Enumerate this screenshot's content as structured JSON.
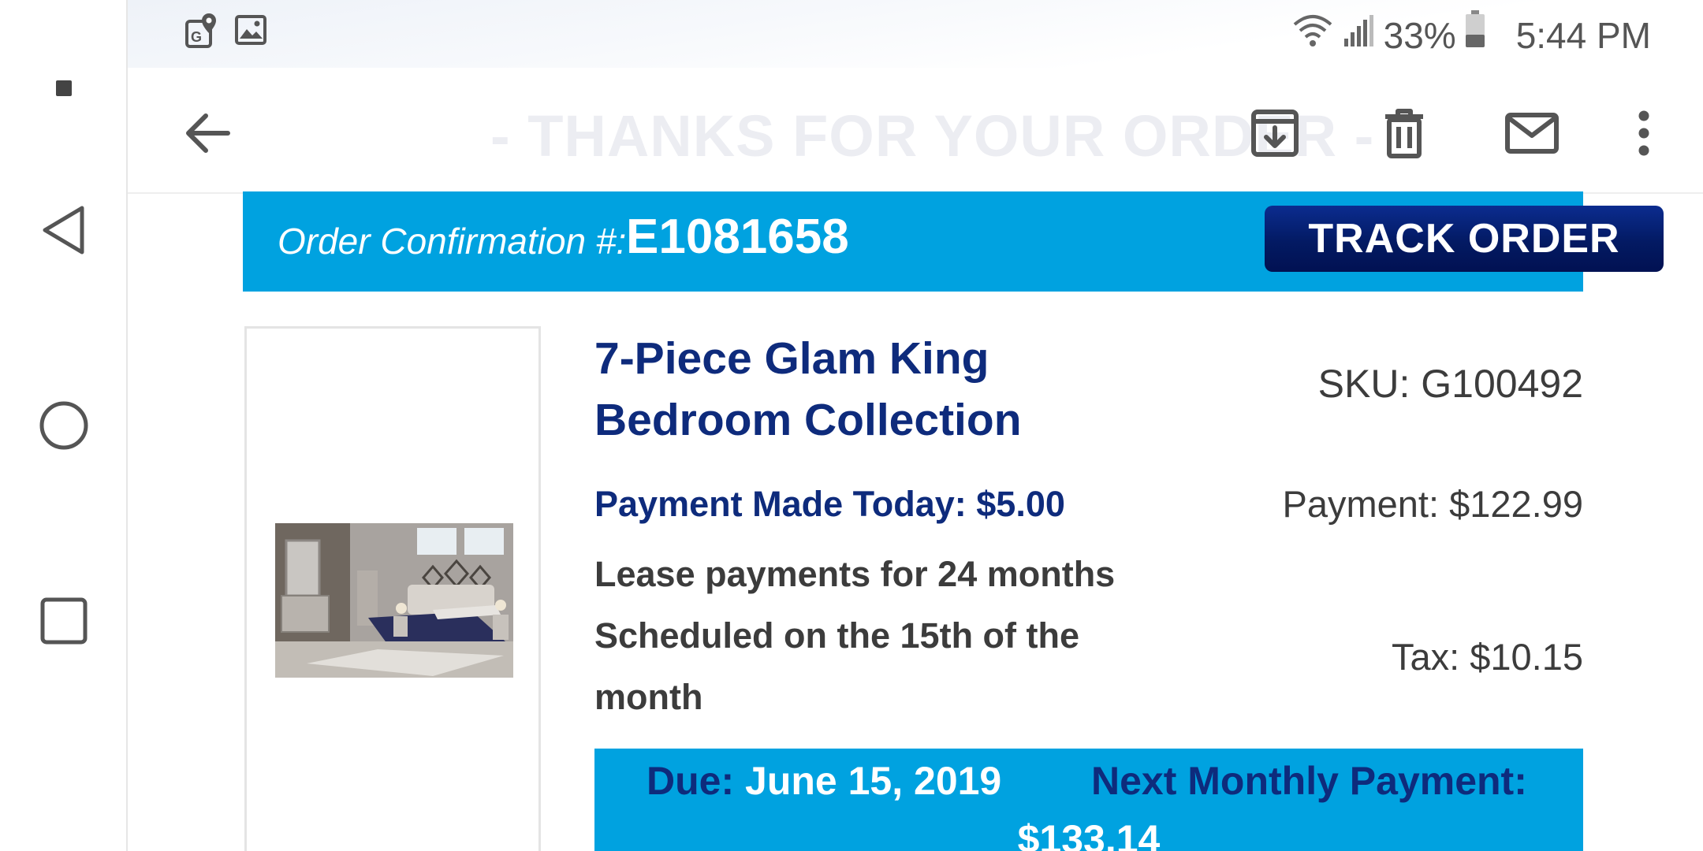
{
  "status_bar": {
    "battery": "33%",
    "time": "5:44 PM",
    "icons": [
      "maps-notification-icon",
      "gallery-notification-icon",
      "wifi-icon",
      "signal-icon",
      "battery-icon"
    ]
  },
  "nav_bar": {
    "icons": [
      "menu-dot-icon",
      "back-triangle-icon",
      "home-circle-icon",
      "recents-square-icon"
    ]
  },
  "toolbar": {
    "faded_heading": "- THANKS FOR YOUR ORDER -",
    "icons": [
      "back-arrow-icon",
      "archive-icon",
      "delete-icon",
      "mail-icon",
      "more-vert-icon"
    ]
  },
  "order": {
    "confirmation_label": "Order Confirmation #:",
    "confirmation_number": "E1081658",
    "track_button": "TRACK ORDER"
  },
  "product": {
    "title": "7-Piece Glam King Bedroom Collection",
    "sku": "SKU: G100492",
    "payment_made_today": "Payment Made Today: $5.00",
    "payment": "Payment: $122.99",
    "lease_text": "Lease payments for 24 months Scheduled on the 15th of the month",
    "tax": "Tax: $10.15"
  },
  "due": {
    "due_label": "Due:",
    "due_date": "June 15, 2019",
    "next_label": "Next Monthly Payment:",
    "next_amount": "$133.14"
  },
  "colors": {
    "banner_blue": "#00a2e0",
    "navy": "#0e2b7c",
    "button_navy": "#031a63",
    "text_gray": "#3c3c3c"
  }
}
